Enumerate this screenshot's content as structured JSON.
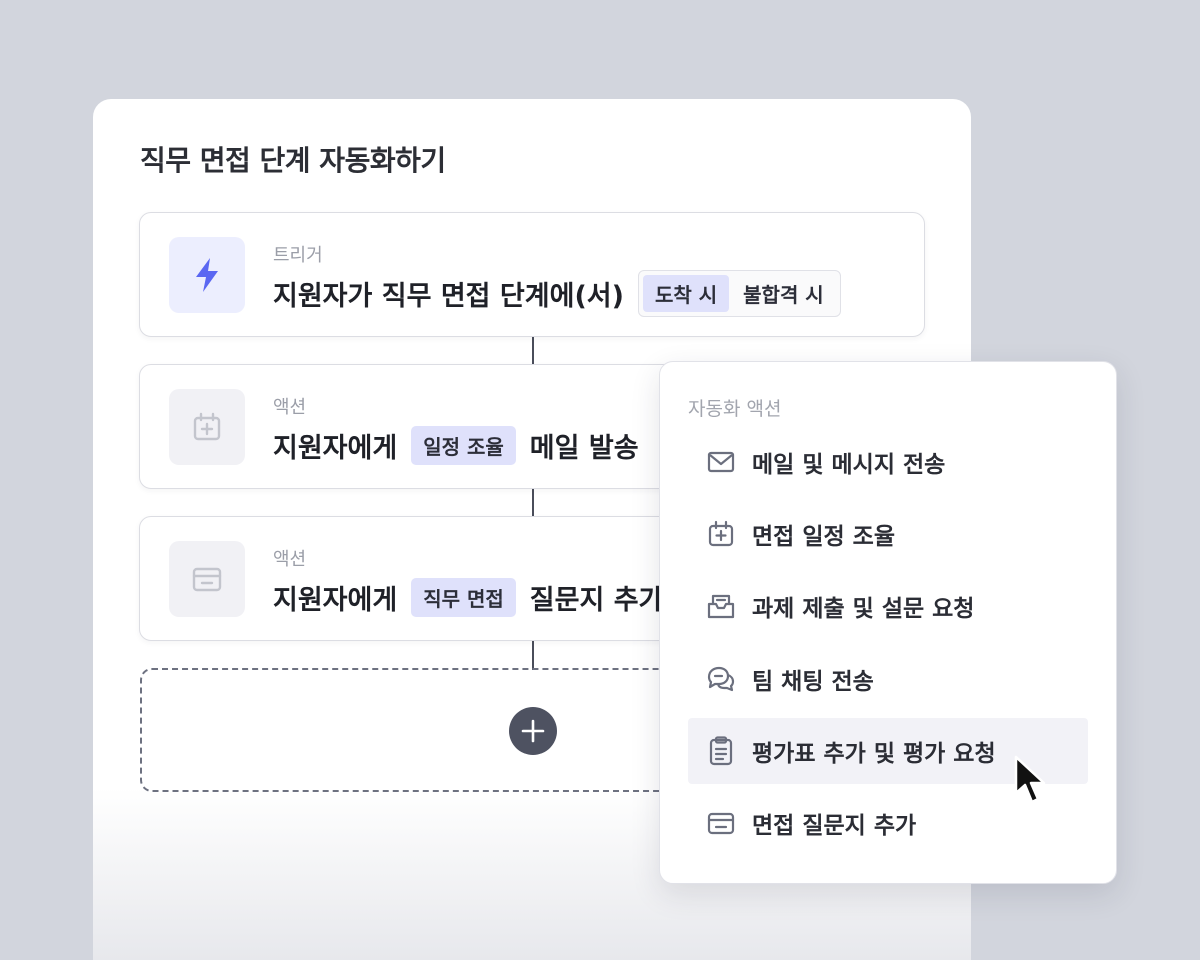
{
  "card": {
    "title": "직무 면접 단계 자동화하기"
  },
  "trigger": {
    "kind": "트리거",
    "text": "지원자가 직무 면접 단계에(서)",
    "options": [
      "도착 시",
      "불합격 시"
    ],
    "selected": "도착 시",
    "icon": "lightning-icon"
  },
  "actions": [
    {
      "kind": "액션",
      "prefix": "지원자에게",
      "chip": "일정 조율",
      "suffix": "메일 발송",
      "icon": "calendar-plus-icon"
    },
    {
      "kind": "액션",
      "prefix": "지원자에게",
      "chip": "직무 면접",
      "suffix": "질문지 추가",
      "icon": "card-icon"
    }
  ],
  "dropdown": {
    "title": "자동화 액션",
    "items": [
      {
        "label": "메일 및 메시지 전송",
        "icon": "mail-icon"
      },
      {
        "label": "면접 일정 조율",
        "icon": "calendar-plus-icon"
      },
      {
        "label": "과제 제출 및 설문 요청",
        "icon": "inbox-icon"
      },
      {
        "label": "팀 채팅 전송",
        "icon": "chat-bubbles-icon"
      },
      {
        "label": "평가표 추가 및 평가 요청",
        "icon": "clipboard-icon"
      },
      {
        "label": "면접 질문지 추가",
        "icon": "card-icon"
      }
    ],
    "hovered_index": 4
  },
  "colors": {
    "accent": "#5a67f2",
    "chip_bg": "#dfe1fb",
    "icon_gray": "#6b6f7e",
    "background": "#d2d5dd"
  }
}
